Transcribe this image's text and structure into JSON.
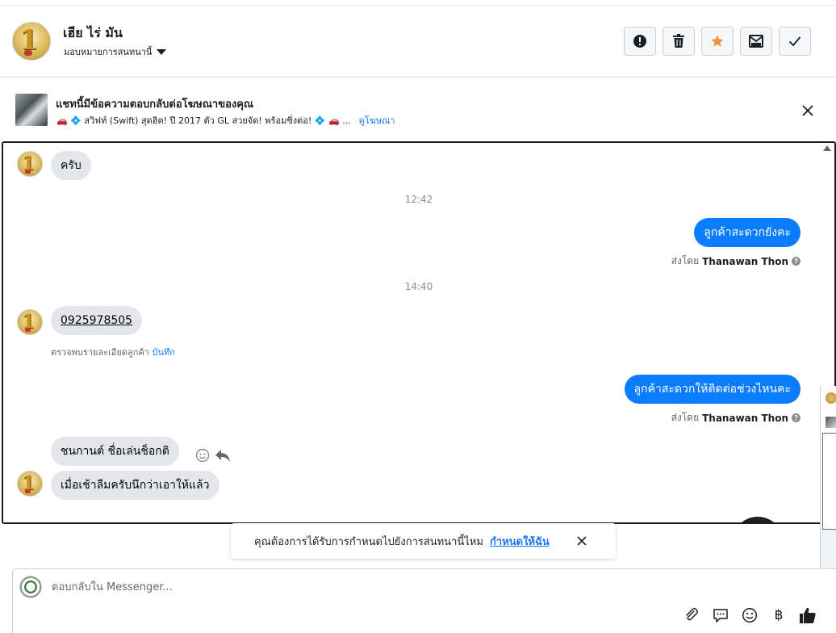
{
  "header": {
    "contact_name": "เฮีย ไร่ มัน",
    "assign_label": "มอบหมายการสนทนานี้",
    "actions": [
      "mark-spam",
      "delete",
      "star",
      "mark-unread",
      "mark-done"
    ]
  },
  "ad_banner": {
    "title": "แชทนี้มีข้อความตอบกลับต่อโฆษณาของคุณ",
    "subtitle": "🚗 💠 สวิฟท์ (Swift) สุดฮิต! ปี 2017 ตัว GL สวยจัด! พร้อมซิ่งต่อ! 💠 🚗 ...",
    "link": "ดูโฆษณา"
  },
  "conversation": {
    "messages": [
      {
        "dir": "in",
        "text": "ครับ"
      },
      {
        "time": "12:42"
      },
      {
        "dir": "out",
        "text": "ลูกค้าสะดวกยังคะ"
      },
      {
        "time": "14:40"
      },
      {
        "dir": "in",
        "text": "0925978505"
      },
      {
        "dir": "out",
        "text": "ลูกค้าสะดวกให้ติดต่อช่วงไหนคะ"
      },
      {
        "dir": "in",
        "text": "ชนกานต์ ชื่อเล่นช็อกติ"
      },
      {
        "dir": "in",
        "text": "เมื่อเช้าลืมครับนึกว่าเอาให้แล้ว"
      }
    ],
    "msg1": "ครับ",
    "time1": "12:42",
    "msg2": "ลูกค้าสะดวกยังคะ",
    "time2": "14:40",
    "msg3": "0925978505",
    "msg4": "ลูกค้าสะดวกให้ติดต่อช่วงไหนคะ",
    "msg5": "ชนกานต์ ชื่อเล่นช็อกติ",
    "msg6": "เมื่อเช้าลืมครับนึกว่าเอาให้แล้ว",
    "sent_by_prefix": "ส่งโดย",
    "sender_name": "Thanawan Thon",
    "detail_note": "ตรวจพบรายละเอียดลูกค้า",
    "save_link": "บันทึก"
  },
  "reminder": {
    "text": "คุณต้องการได้รับการกำหนดไปยังการสนทนานี้ไหม",
    "link": "กำหนดให้ฉัน"
  },
  "composer": {
    "placeholder": "ตอบกลับใน Messenger...",
    "tools": [
      "attach-icon",
      "saved-replies-icon",
      "emoji-icon",
      "baht-icon",
      "like-icon"
    ]
  },
  "colors": {
    "outgoing_bubble": "#0a7cff",
    "incoming_bubble": "#e4e6eb",
    "link": "#1877f2",
    "star": "#f7923a"
  }
}
